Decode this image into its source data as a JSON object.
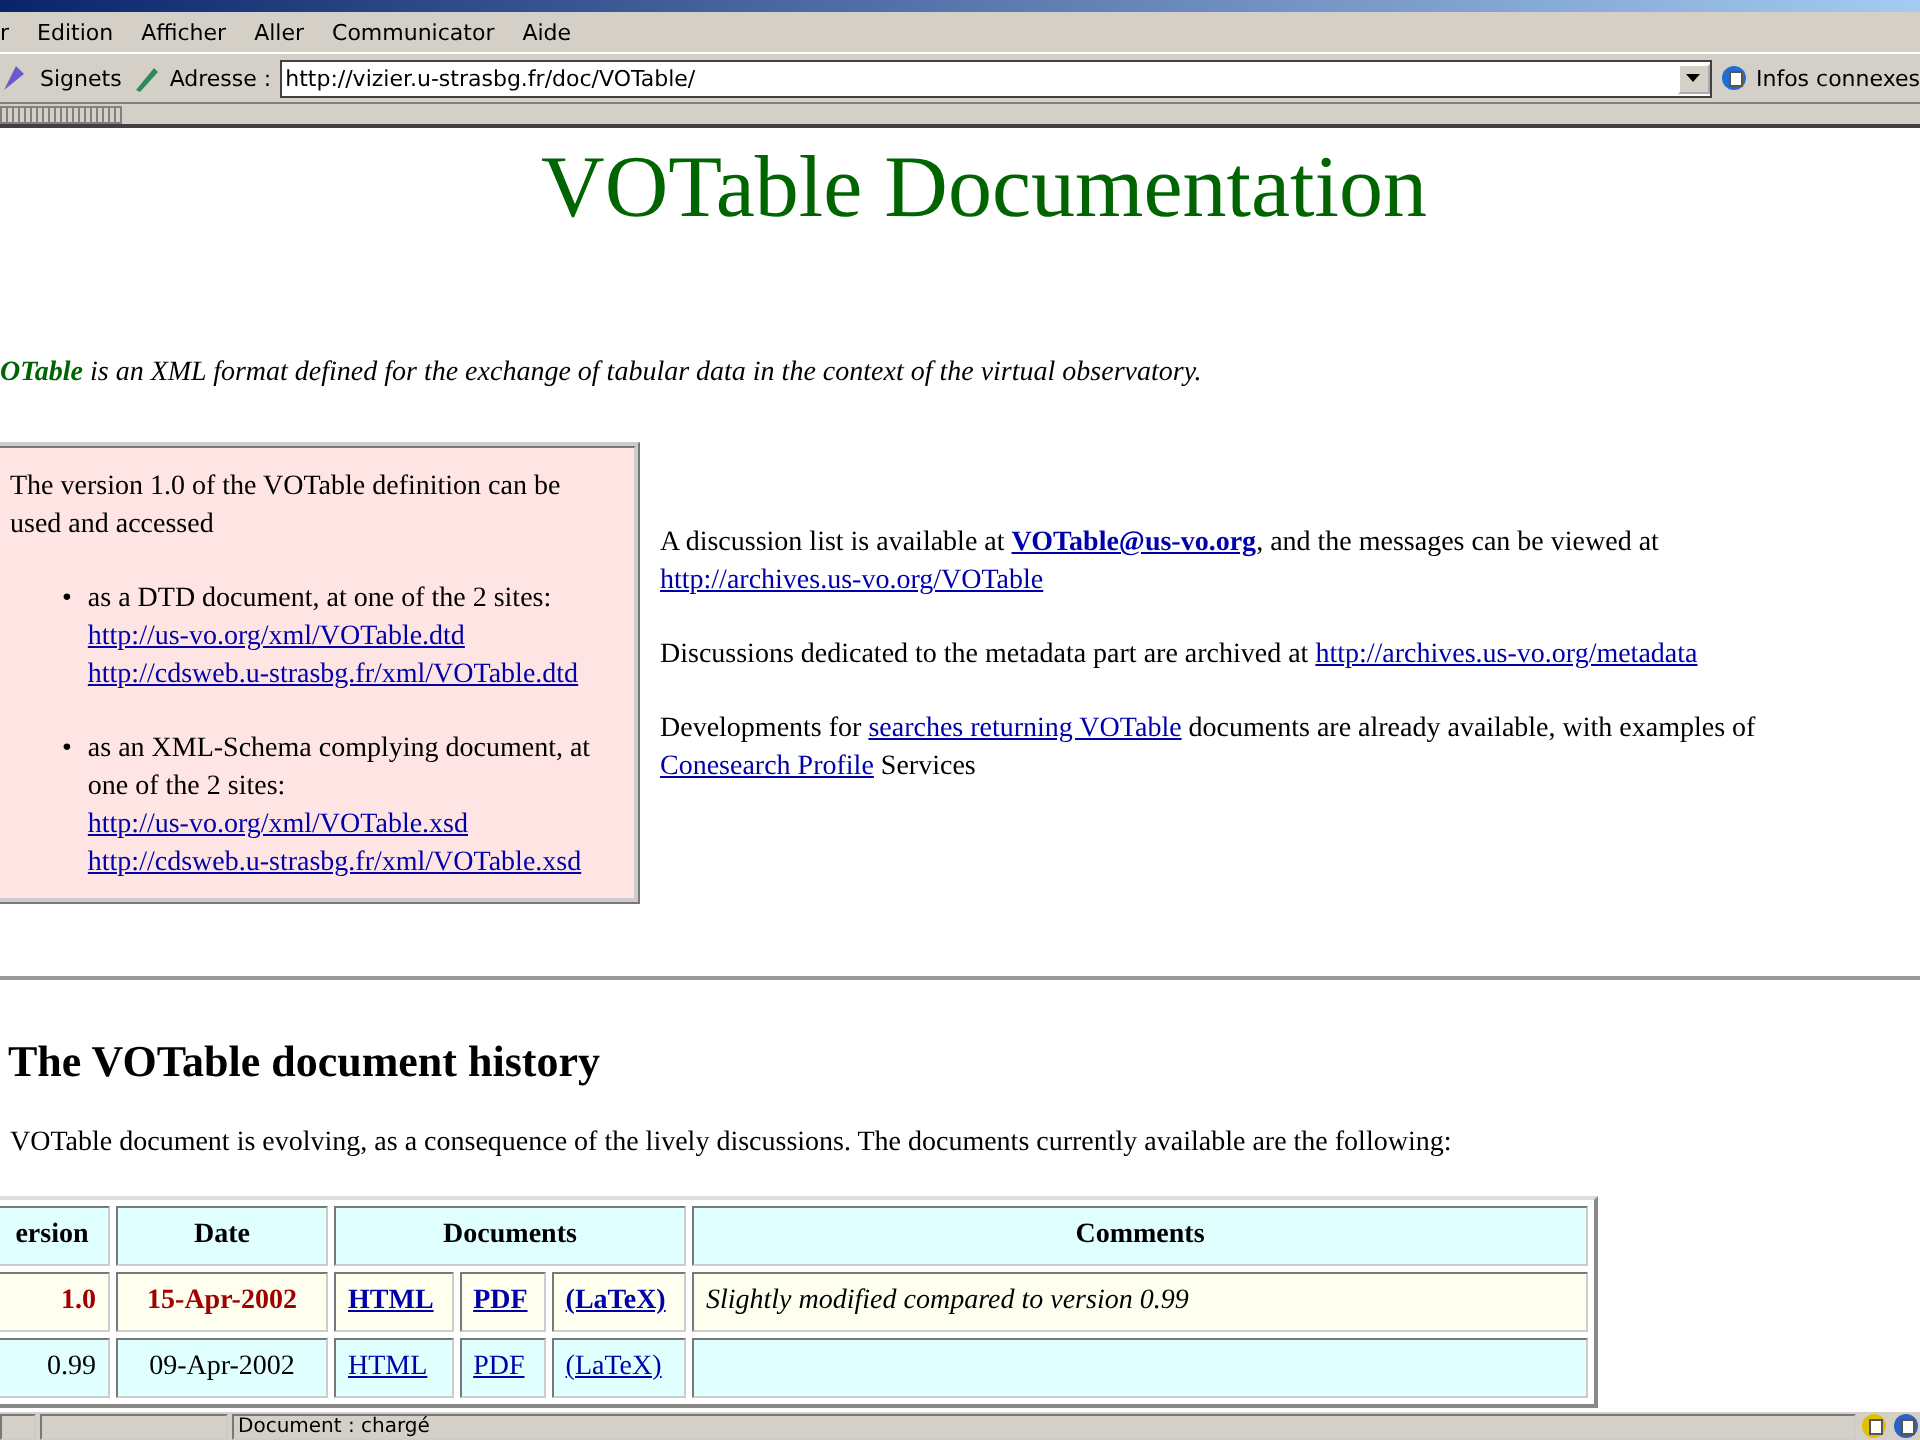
{
  "menu": [
    "r",
    "Edition",
    "Afficher",
    "Aller",
    "Communicator",
    "Aide"
  ],
  "toolbar": {
    "bookmarks": "Signets",
    "address_label": "Adresse :",
    "address": "http://vizier.u-strasbg.fr/doc/VOTable/",
    "related": "Infos connexes"
  },
  "page": {
    "title": "VOTable Documentation",
    "intro": {
      "lead": "OTable",
      "text": " is an XML format defined for the exchange of tabular data in the context of the virtual observatory."
    },
    "box": {
      "text": "The version 1.0 of the VOTable definition can be used and accessed",
      "items": [
        {
          "bullet": "•",
          "text": "as a DTD document, at one of the 2 sites:",
          "links": [
            "http://us-vo.org/xml/VOTable.dtd",
            "http://cdsweb.u-strasbg.fr/xml/VOTable.dtd"
          ]
        },
        {
          "bullet": "•",
          "text": "as an XML-Schema complying document, at one of the 2 sites:",
          "links": [
            "http://us-vo.org/xml/VOTable.xsd",
            "http://cdsweb.u-strasbg.fr/xml/VOTable.xsd"
          ]
        }
      ]
    },
    "paragraphs": [
      [
        {
          "kind": "text",
          "text": "A discussion list is available at "
        },
        {
          "kind": "strong-link",
          "text": "VOTable@us-vo.org"
        },
        {
          "kind": "text",
          "text": ", and the messages can be viewed at "
        },
        {
          "kind": "link",
          "text": "http://archives.us-vo.org/VOTable"
        }
      ],
      [
        {
          "kind": "text",
          "text": "Discussions dedicated to the metadata part are archived at "
        },
        {
          "kind": "link",
          "text": "http://archives.us-vo.org/metadata"
        }
      ],
      [
        {
          "kind": "text",
          "text": "Developments for "
        },
        {
          "kind": "link",
          "text": "searches returning VOTable"
        },
        {
          "kind": "text",
          "text": " documents are already available, with examples of "
        },
        {
          "kind": "link",
          "text": "Conesearch Profile"
        },
        {
          "kind": "text",
          "text": " Services"
        }
      ]
    ],
    "history_title": "The VOTable document history",
    "history_text": "VOTable document is evolving, as a consequence of the lively discussions. The documents currently available are the following:",
    "table": {
      "columns": [
        "ersion",
        "Date",
        "Documents",
        "Comments"
      ],
      "rows": [
        {
          "highlighted": true,
          "version": "1.0",
          "date": "15-Apr-2002",
          "documents": [
            "HTML",
            "PDF",
            "(LaTeX)"
          ],
          "comment": "Slightly modified compared to version 0.99"
        },
        {
          "highlighted": false,
          "version": "0.99",
          "date": "09-Apr-2002",
          "documents": [
            "HTML",
            "PDF",
            "(LaTeX)"
          ]
        }
      ]
    }
  },
  "status": "Document : chargé"
}
